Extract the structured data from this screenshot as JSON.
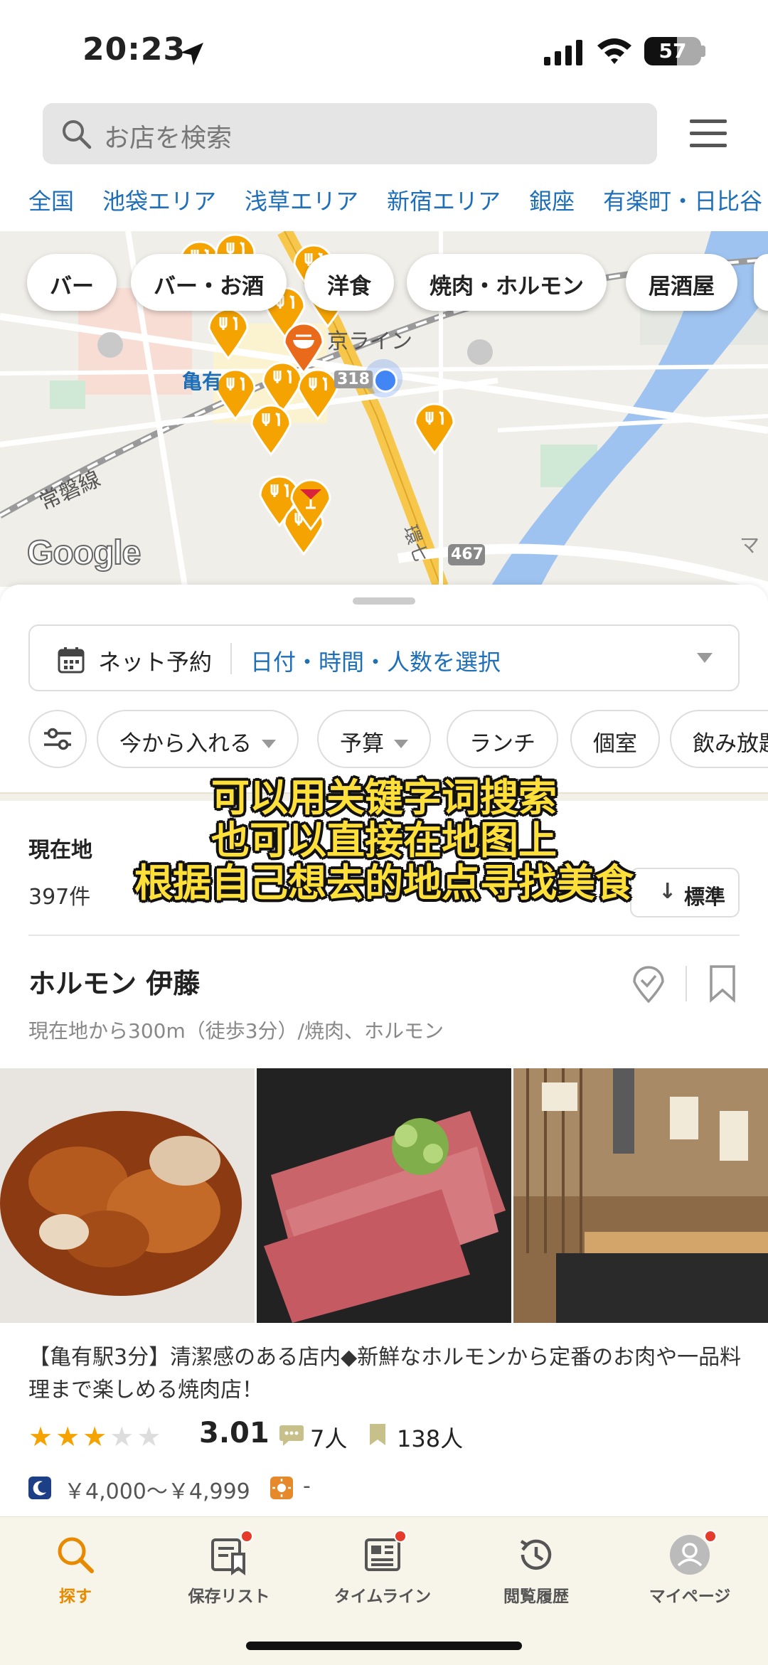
{
  "status_bar": {
    "time": "20:23",
    "battery": "57"
  },
  "search": {
    "placeholder": "お店を検索"
  },
  "areas": [
    "全国",
    "池袋エリア",
    "浅草エリア",
    "新宿エリア",
    "銀座",
    "有楽町・日比谷"
  ],
  "map": {
    "categories": [
      "バー",
      "バー・お酒",
      "洋食",
      "焼肉・ホルモン",
      "居酒屋"
    ],
    "labels": {
      "station": "亀有",
      "line1": "常磐線",
      "line2": "京ライン",
      "road": "環七",
      "route318": "318",
      "route467": "467",
      "edge": "マ"
    },
    "provider": "Google"
  },
  "reservation": {
    "label": "ネット予約",
    "selector": "日付・時間・人数を選択"
  },
  "filters": [
    "今から入れる",
    "予算",
    "ランチ",
    "個室",
    "飲み放題"
  ],
  "results": {
    "location": "現在地",
    "count": "397件",
    "sort": "標準"
  },
  "shop": {
    "name": "ホルモン 伊藤",
    "subtitle": "現在地から300m（徒歩3分）/焼肉、ホルモン",
    "description": "【亀有駅3分】清潔感のある店内◆新鮮なホルモンから定番のお肉や一品料理まで楽しめる焼肉店！",
    "rating": 3.01,
    "stars_filled": 3,
    "reviews": "7人",
    "saves": "138人",
    "dinner_price": "￥4,000～￥4,999",
    "lunch_price": "-"
  },
  "caption": [
    "可以用关键字词搜索",
    "也可以直接在地图上",
    "根据自己想去的地点寻找美食"
  ],
  "nav": [
    {
      "label": "探す",
      "icon": "search-icon"
    },
    {
      "label": "保存リスト",
      "icon": "saved-list-icon"
    },
    {
      "label": "タイムライン",
      "icon": "timeline-icon"
    },
    {
      "label": "閲覧履歴",
      "icon": "history-icon"
    },
    {
      "label": "マイページ",
      "icon": "profile-icon"
    }
  ],
  "colors": {
    "accent": "#e88a00",
    "link": "#1e6fb8",
    "pin": "#f5a300",
    "star": "#f5a300",
    "caption": "#ffe03a",
    "badge": "#e53b2c"
  }
}
